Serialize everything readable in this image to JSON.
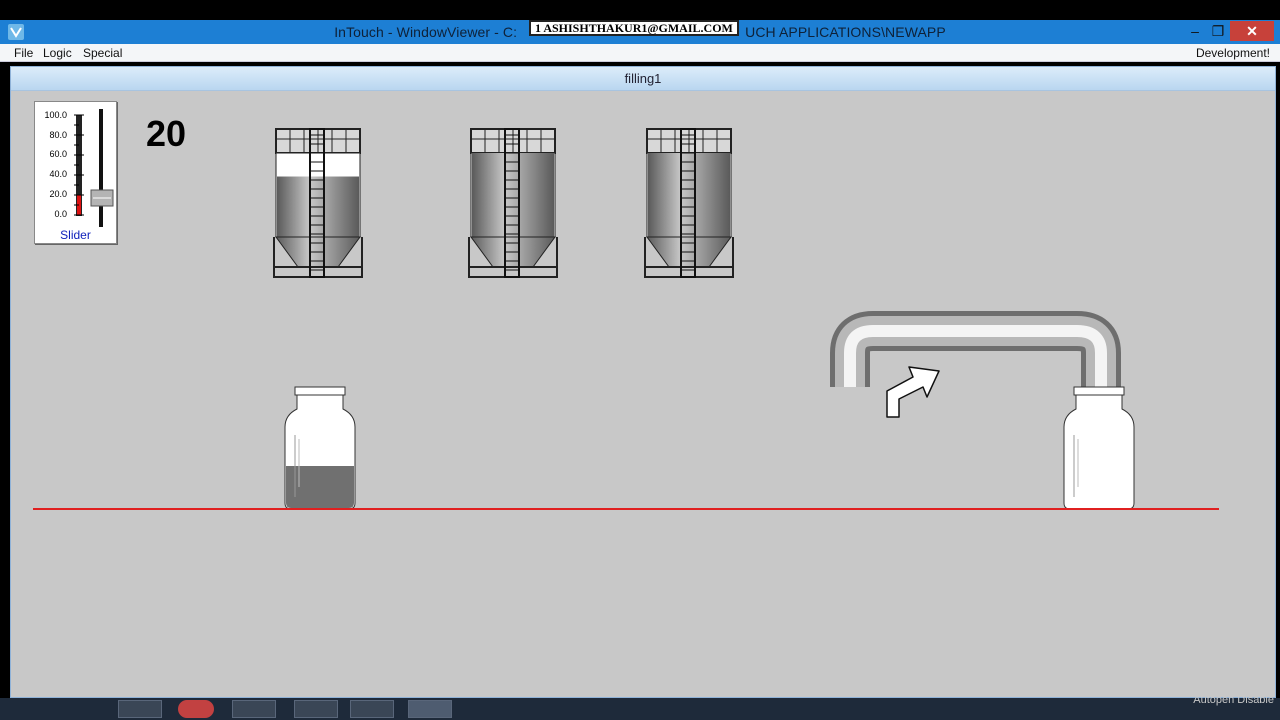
{
  "window": {
    "title_left": "InTouch - WindowViewer - C:",
    "title_right": "UCH APPLICATIONS\\NEWAPP",
    "watermark": "1 ASHISHTHAKUR1@GMAIL.COM",
    "minimize_glyph": "–",
    "maximize_glyph": "❐",
    "close_glyph": "✕"
  },
  "menu": {
    "file": "File",
    "logic": "Logic",
    "special": "Special",
    "development": "Development!"
  },
  "screen": {
    "name": "filling1",
    "slider": {
      "caption": "Slider",
      "ticks": [
        "100.0",
        "80.0",
        "60.0",
        "40.0",
        "20.0",
        "0.0"
      ],
      "value": 20
    },
    "value_display": "20",
    "tanks": [
      {
        "name": "tank-1",
        "level_fraction": 0.72
      },
      {
        "name": "tank-2",
        "level_fraction": 1.0
      },
      {
        "name": "tank-3",
        "level_fraction": 1.0
      }
    ],
    "bottle_fill_fractions": [
      0.38,
      0.0
    ]
  },
  "footer": {
    "autopen_text": "Autopen Disable"
  },
  "colors": {
    "titlebar": "#1d7fd4",
    "canvas": "#c8c8c8",
    "conveyor": "#e02020",
    "liquid": "#707070",
    "slider_fill": "#dd1111"
  }
}
